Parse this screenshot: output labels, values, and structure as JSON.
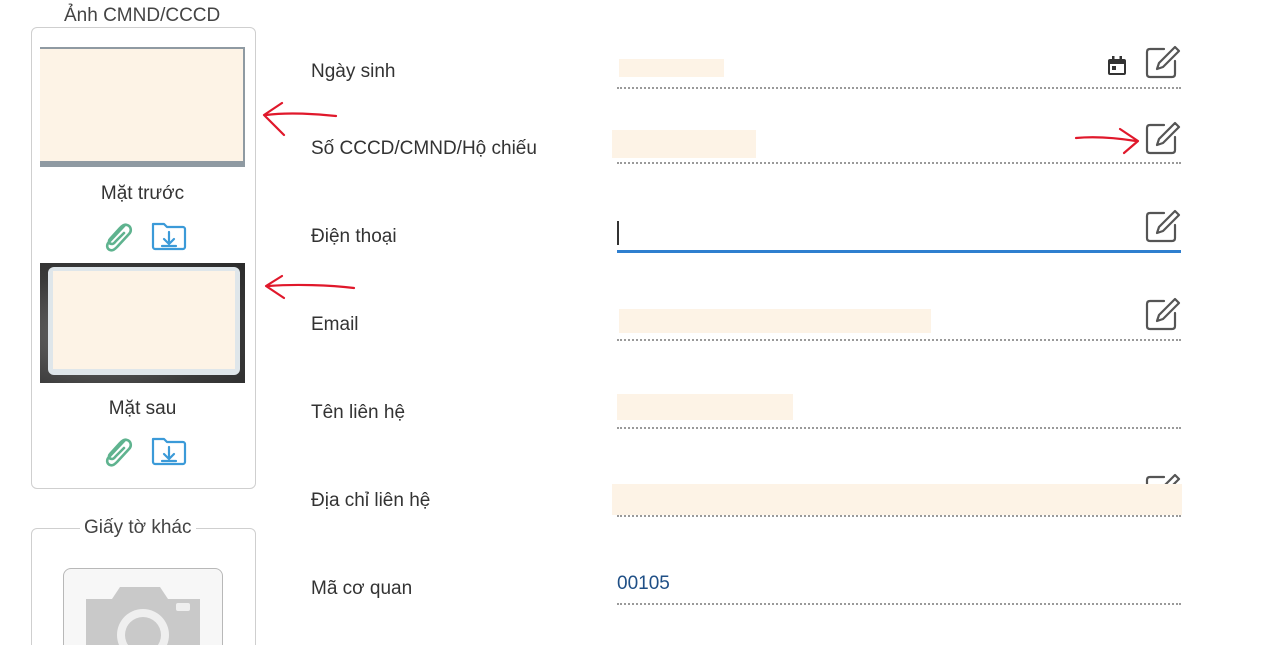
{
  "id_panel": {
    "title": "Ảnh CMND/CCCD",
    "front_caption": "Mặt trước",
    "back_caption": "Mặt sau"
  },
  "other_panel": {
    "title": "Giấy tờ khác"
  },
  "icons": {
    "attach": "paperclip-icon",
    "download": "folder-download-icon",
    "edit": "pencil-edit-icon",
    "calendar": "calendar-icon",
    "camera": "camera-icon"
  },
  "colors": {
    "attach_icon": "#5fb38f",
    "download_icon": "#3b9ad8",
    "active_underline": "#2f7fcf",
    "annotation_arrow": "#e0182b",
    "value_text": "#1f4f86",
    "redaction": "#fdf3e6"
  },
  "form": {
    "dob_label": "Ngày sinh",
    "id_label": "Số CCCD/CMND/Hộ chiếu",
    "phone_label": "Điện thoại",
    "phone_value": "",
    "email_label": "Email",
    "contact_name_label": "Tên liên hệ",
    "address_label": "Địa chỉ liên hệ",
    "agency_label": "Mã cơ quan",
    "agency_value": "00105"
  }
}
